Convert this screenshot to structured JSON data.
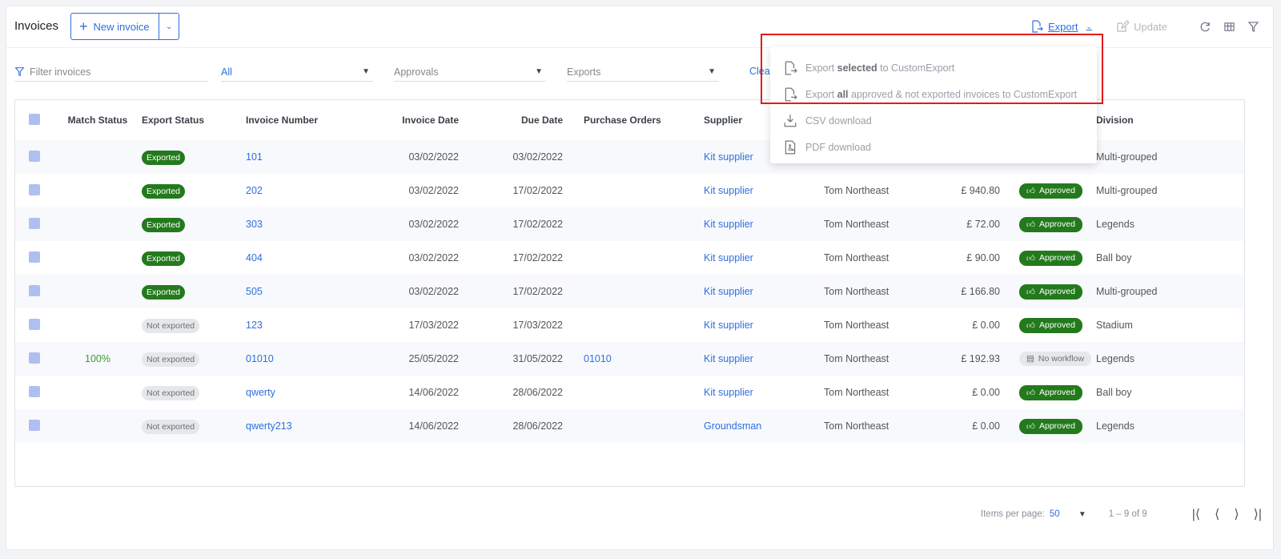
{
  "header": {
    "title": "Invoices",
    "new_invoice_label": "New invoice",
    "export_label": "Export",
    "update_label": "Update"
  },
  "filters": {
    "search_placeholder": "Filter invoices",
    "status_value": "All",
    "approvals_value": "Approvals",
    "exports_value": "Exports",
    "clear_label": "Clea"
  },
  "table": {
    "columns": [
      "Match Status",
      "Export Status",
      "Invoice Number",
      "Invoice Date",
      "Due Date",
      "Purchase Orders",
      "Supplier",
      "",
      "",
      "",
      "Division"
    ],
    "rows": [
      {
        "match": "",
        "export": "Exported",
        "number": "101",
        "invoice_date": "03/02/2022",
        "due_date": "03/02/2022",
        "po": "",
        "supplier": "Kit supplier",
        "person": "",
        "amount": "",
        "approval": "",
        "division": "Multi-grouped"
      },
      {
        "match": "",
        "export": "Exported",
        "number": "202",
        "invoice_date": "03/02/2022",
        "due_date": "17/02/2022",
        "po": "",
        "supplier": "Kit supplier",
        "person": "Tom Northeast",
        "amount": "£ 940.80",
        "approval": "Approved",
        "division": "Multi-grouped"
      },
      {
        "match": "",
        "export": "Exported",
        "number": "303",
        "invoice_date": "03/02/2022",
        "due_date": "17/02/2022",
        "po": "",
        "supplier": "Kit supplier",
        "person": "Tom Northeast",
        "amount": "£ 72.00",
        "approval": "Approved",
        "division": "Legends"
      },
      {
        "match": "",
        "export": "Exported",
        "number": "404",
        "invoice_date": "03/02/2022",
        "due_date": "17/02/2022",
        "po": "",
        "supplier": "Kit supplier",
        "person": "Tom Northeast",
        "amount": "£ 90.00",
        "approval": "Approved",
        "division": "Ball boy"
      },
      {
        "match": "",
        "export": "Exported",
        "number": "505",
        "invoice_date": "03/02/2022",
        "due_date": "17/02/2022",
        "po": "",
        "supplier": "Kit supplier",
        "person": "Tom Northeast",
        "amount": "£ 166.80",
        "approval": "Approved",
        "division": "Multi-grouped"
      },
      {
        "match": "",
        "export": "Not exported",
        "number": "123",
        "invoice_date": "17/03/2022",
        "due_date": "17/03/2022",
        "po": "",
        "supplier": "Kit supplier",
        "person": "Tom Northeast",
        "amount": "£ 0.00",
        "approval": "Approved",
        "division": "Stadium"
      },
      {
        "match": "100%",
        "export": "Not exported",
        "number": "01010",
        "invoice_date": "25/05/2022",
        "due_date": "31/05/2022",
        "po": "01010",
        "supplier": "Kit supplier",
        "person": "Tom Northeast",
        "amount": "£ 192.93",
        "approval": "No workflow",
        "division": "Legends"
      },
      {
        "match": "",
        "export": "Not exported",
        "number": "qwerty",
        "invoice_date": "14/06/2022",
        "due_date": "28/06/2022",
        "po": "",
        "supplier": "Kit supplier",
        "person": "Tom Northeast",
        "amount": "£ 0.00",
        "approval": "Approved",
        "division": "Ball boy"
      },
      {
        "match": "",
        "export": "Not exported",
        "number": "qwerty213",
        "invoice_date": "14/06/2022",
        "due_date": "28/06/2022",
        "po": "",
        "supplier": "Groundsman",
        "person": "Tom Northeast",
        "amount": "£ 0.00",
        "approval": "Approved",
        "division": "Legends"
      }
    ]
  },
  "export_menu": {
    "item1_pre": "Export",
    "item1_bold": "selected",
    "item1_post": "to CustomExport",
    "item2_pre": "Export",
    "item2_bold": "all",
    "item2_post": "approved & not exported invoices to CustomExport",
    "csv_label": "CSV download",
    "pdf_label": "PDF download"
  },
  "pagination": {
    "items_per_page_label": "Items per page:",
    "items_per_page_value": "50",
    "range_label": "1 – 9 of 9"
  },
  "colors": {
    "accent": "#2f6fe0",
    "exported_green": "#237a1c",
    "highlight_red": "#e21b1b"
  }
}
